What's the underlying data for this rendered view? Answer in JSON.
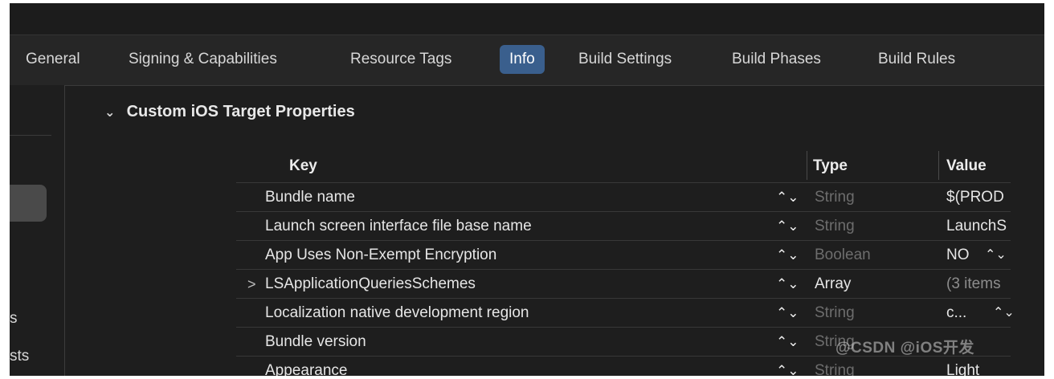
{
  "tabs": [
    {
      "label": "General"
    },
    {
      "label": "Signing & Capabilities"
    },
    {
      "label": "Resource Tags"
    },
    {
      "label": "Info",
      "active": true
    },
    {
      "label": "Build Settings"
    },
    {
      "label": "Build Phases"
    },
    {
      "label": "Build Rules"
    }
  ],
  "sidebar": {
    "fragment_1": "s",
    "fragment_2": "sts"
  },
  "section": {
    "chevron": "⌄",
    "title": "Custom iOS Target Properties"
  },
  "columns": {
    "key": "Key",
    "type": "Type",
    "value": "Value"
  },
  "rows": [
    {
      "key": "Bundle name",
      "type": "String",
      "value": "$(PROD",
      "stepper": "⌃⌄"
    },
    {
      "key": "Launch screen interface file base name",
      "type": "String",
      "value": "LaunchS",
      "stepper": "⌃⌄"
    },
    {
      "key": "App Uses Non-Exempt Encryption",
      "type": "Boolean",
      "value": "NO",
      "stepper": "⌃⌄",
      "value_stepper": "⌃⌄"
    },
    {
      "key": "LSApplicationQueriesSchemes",
      "type": "Array",
      "value": "(3 items",
      "stepper": "⌃⌄",
      "disclosure": ">"
    },
    {
      "key": "Localization native development region",
      "type": "String",
      "value": "c...",
      "stepper": "⌃⌄",
      "value_stepper": "⌃⌄"
    },
    {
      "key": "Bundle version",
      "type": "String",
      "value": "",
      "stepper": "⌃⌄"
    },
    {
      "key": "Appearance",
      "type": "String",
      "value": "Light",
      "stepper": "⌃⌄"
    }
  ],
  "watermark": "@CSDN @iOS开发"
}
